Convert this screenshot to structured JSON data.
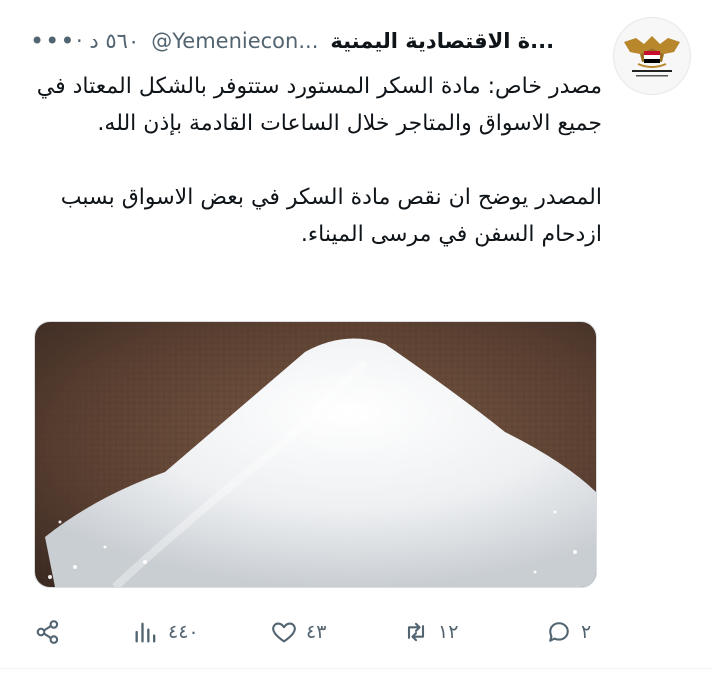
{
  "header": {
    "name": "...ة الاقتصادية اليمنية",
    "handle": "@Yemeniecon...",
    "time": "٥٦٠ د ·",
    "more": "•••"
  },
  "tweet": {
    "paragraph1": "مصدر خاص: مادة السكر المستورد ستتوفر بالشكل المعتاد في جميع الاسواق والمتاجر خلال الساعات القادمة بإذن الله.",
    "paragraph2": "المصدر يوضح ان نقص مادة السكر في بعض الاسواق بسبب ازدحام السفن في مرسى الميناء."
  },
  "media": {
    "description_icon": "sugar-photo"
  },
  "actions": {
    "replies": "٢",
    "retweets": "١٢",
    "likes": "٤٣",
    "views": "٤٤٠"
  },
  "colors": {
    "text": "#0f1419",
    "secondary": "#536471",
    "avatar_emblem": "#b8862b",
    "avatar_flag_red": "#c8102e"
  }
}
